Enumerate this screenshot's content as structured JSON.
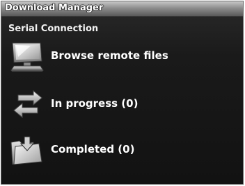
{
  "window": {
    "title": "Download Manager"
  },
  "header": {
    "connection_label": "Serial Connection"
  },
  "menu": {
    "items": [
      {
        "label": "Browse remote files",
        "icon": "computer-monitor-icon"
      },
      {
        "label": "In progress (0)",
        "icon": "transfer-arrows-icon"
      },
      {
        "label": "Completed (0)",
        "icon": "folder-download-icon"
      }
    ]
  },
  "colors": {
    "background": "#161616",
    "titlebar": "#8e8e8e",
    "text": "#ffffff"
  }
}
